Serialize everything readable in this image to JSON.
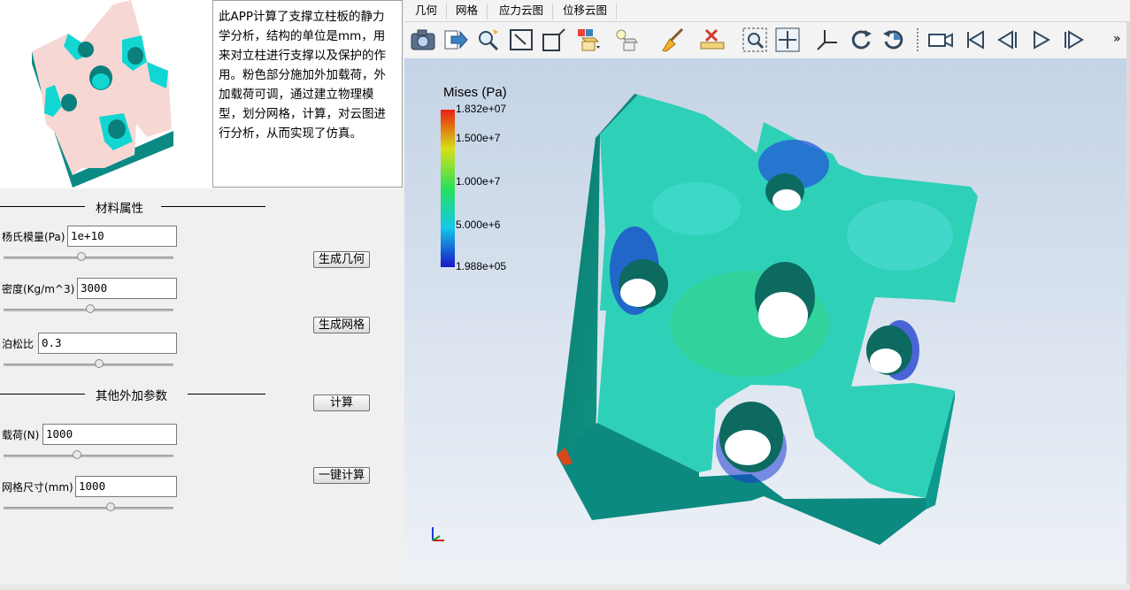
{
  "description": "此APP计算了支撑立柱板的静力学分析，结构的单位是mm，用来对立柱进行支撑以及保护的作用。粉色部分施加外加载荷，外加载荷可调，通过建立物理模型，划分网格，计算，对云图进行分析，从而实现了仿真。",
  "sections": {
    "material": "材料属性",
    "other": "其他外加参数"
  },
  "params": {
    "youngs_modulus": {
      "label": "杨氏模量(Pa)",
      "value": "1e+10",
      "slider": 0.46
    },
    "density": {
      "label": "密度(Kg/m^3)",
      "value": "3000",
      "slider": 0.51
    },
    "poisson": {
      "label": "泊松比",
      "value": "0.3",
      "slider": 0.56
    },
    "load": {
      "label": "载荷(N)",
      "value": "1000",
      "slider": 0.43
    },
    "mesh_size": {
      "label": "网格尺寸(mm)",
      "value": "1000",
      "slider": 0.63
    }
  },
  "buttons": {
    "gen_geometry": "生成几何",
    "gen_mesh": "生成网格",
    "compute": "计算",
    "one_click": "一键计算"
  },
  "tabs": [
    "几何",
    "网格",
    "应力云图",
    "位移云图"
  ],
  "toolbar_icons": [
    "camera-icon",
    "export-icon",
    "zoom-icon",
    "fit-view-icon",
    "box-view-icon",
    "color-icon",
    "light-icon",
    "clear-icon",
    "measure-icon",
    "zoom-box-icon",
    "move-icon",
    "axes-icon",
    "rotate-cw-icon",
    "rotate-ccw-icon",
    "video-icon",
    "first-frame-icon",
    "prev-frame-icon",
    "play-icon",
    "last-frame-icon",
    "more-icon"
  ],
  "toolbar_more": "»",
  "colorbar": {
    "title": "Mises (Pa)",
    "max": "1.832e+07",
    "t2": "1.500e+7",
    "t3": "1.000e+7",
    "t4": "5.000e+6",
    "min": "1.988e+05"
  },
  "colors": {
    "accent_model": "#f7d7d4",
    "model_side": "#0a8f8a",
    "hole": "#12d6d2"
  }
}
